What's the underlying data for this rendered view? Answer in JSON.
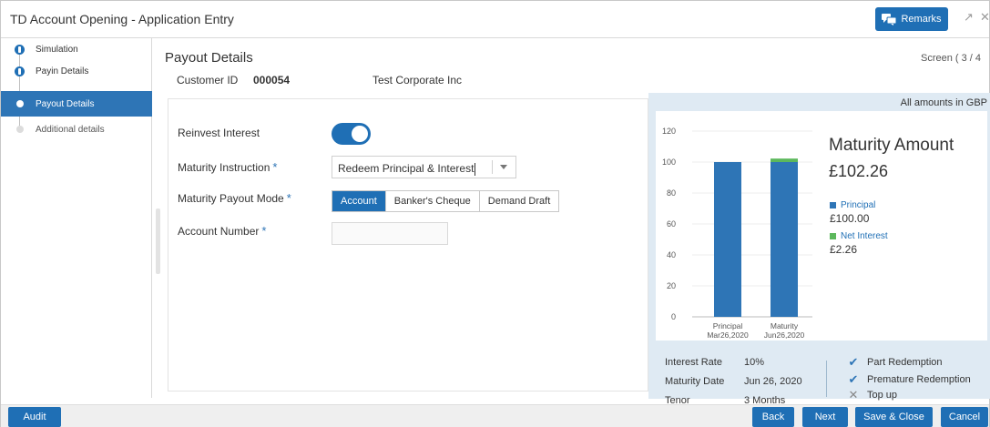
{
  "window": {
    "title": "TD Account Opening - Application Entry",
    "remarks_label": "Remarks"
  },
  "sidebar": {
    "items": [
      {
        "label": "Simulation",
        "state": "done"
      },
      {
        "label": "Payin Details",
        "state": "done"
      },
      {
        "label": "Payout Details",
        "state": "active"
      },
      {
        "label": "Additional details",
        "state": "pending"
      }
    ]
  },
  "main": {
    "title": "Payout Details",
    "screen_indicator": "Screen ( 3 / 4",
    "customer": {
      "id_label": "Customer ID",
      "id_value": "000054",
      "name": "Test Corporate Inc"
    },
    "form": {
      "reinvest_label": "Reinvest Interest",
      "reinvest_on": true,
      "maturity_instruction_label": "Maturity Instruction",
      "maturity_instruction_value": "Redeem Principal & Interest",
      "payout_mode_label": "Maturity Payout Mode",
      "payout_modes": [
        "Account",
        "Banker's Cheque",
        "Demand Draft"
      ],
      "payout_mode_selected": "Account",
      "account_number_label": "Account Number",
      "account_number_value": "",
      "required_mark": "*"
    }
  },
  "summary": {
    "amount_note": "All amounts in GBP",
    "maturity_title": "Maturity Amount",
    "maturity_value": "£102.26",
    "legend": [
      {
        "label": "Principal",
        "value": "£100.00",
        "color": "#2e75b6"
      },
      {
        "label": "Net Interest",
        "value": "£2.26",
        "color": "#5cb85c"
      }
    ],
    "info": [
      {
        "label": "Interest Rate",
        "value": "10%"
      },
      {
        "label": "Maturity Date",
        "value": "Jun 26, 2020"
      },
      {
        "label": "Tenor",
        "value": "3 Months"
      }
    ],
    "checks": [
      {
        "label": "Part Redemption",
        "allowed": true
      },
      {
        "label": "Premature Redemption",
        "allowed": true
      },
      {
        "label": "Top up",
        "allowed": false
      }
    ]
  },
  "chart_data": {
    "type": "bar",
    "categories": [
      "Principal\nMar26,2020",
      "Maturity\nJun26,2020"
    ],
    "category_lines": [
      [
        "Principal",
        "Mar26,2020"
      ],
      [
        "Maturity",
        "Jun26,2020"
      ]
    ],
    "series": [
      {
        "name": "Principal",
        "values": [
          100,
          100
        ],
        "color": "#2e75b6"
      },
      {
        "name": "Net Interest",
        "values": [
          0,
          2.26
        ],
        "color": "#5cb85c"
      }
    ],
    "stacked": true,
    "ylim": [
      0,
      120
    ],
    "yticks": [
      0,
      20,
      40,
      60,
      80,
      100,
      120
    ],
    "grid": true
  },
  "footer": {
    "audit": "Audit",
    "back": "Back",
    "next": "Next",
    "save_close": "Save & Close",
    "cancel": "Cancel"
  }
}
